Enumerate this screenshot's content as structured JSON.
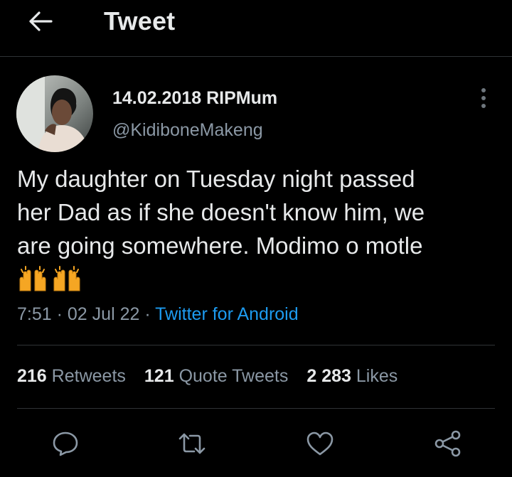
{
  "header": {
    "title": "Tweet",
    "back_icon": "arrow-left-icon"
  },
  "tweet": {
    "display_name": "14.02.2018 RIPMum",
    "handle": "@KidiboneMakeng",
    "text_lines": [
      "My daughter on Tuesday night passed",
      "her Dad as if she doesn't know him, we",
      "are going somewhere. Modimo o motle"
    ],
    "emoji": [
      "raising-hands-emoji",
      "raising-hands-emoji"
    ],
    "time": "7:51",
    "date": "02 Jul 22",
    "separator": "·",
    "source": "Twitter for Android"
  },
  "stats": {
    "retweets_count": "216",
    "retweets_label": "Retweets",
    "quotes_count": "121",
    "quotes_label": "Quote Tweets",
    "likes_count": "2 283",
    "likes_label": "Likes"
  },
  "actions": [
    "reply-icon",
    "retweet-icon",
    "like-icon",
    "share-icon"
  ],
  "colors": {
    "background": "#000000",
    "text": "#e7e9ea",
    "secondary": "#8b98a5",
    "link": "#1d9bf0",
    "divider": "#2f3336"
  }
}
